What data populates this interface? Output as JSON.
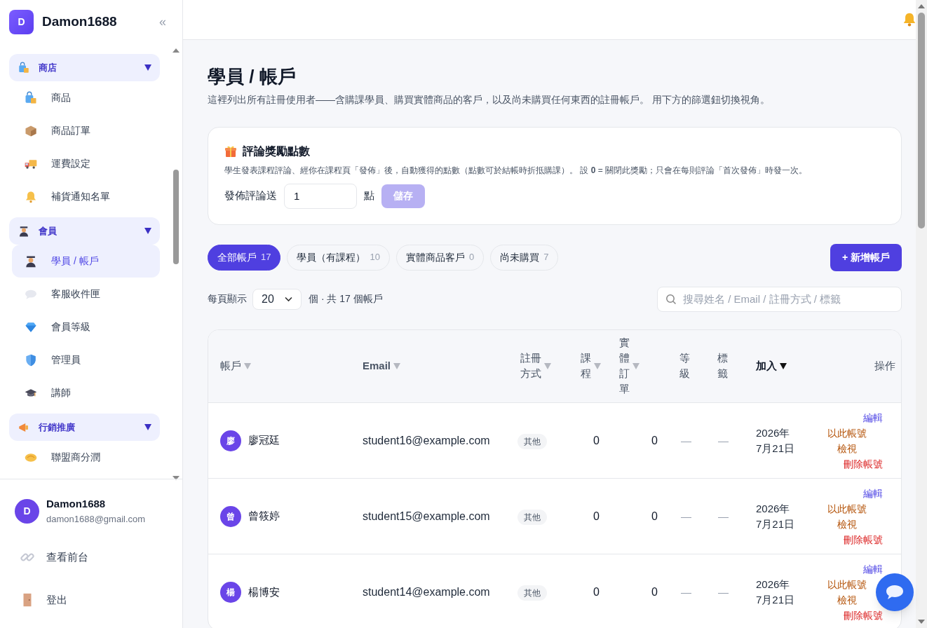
{
  "app": {
    "avatar_letter": "D",
    "name": "Damon1688",
    "collapse": "«"
  },
  "sidebar": {
    "groups": [
      {
        "label": "商店",
        "expanded": true,
        "items": [
          {
            "label": "商品",
            "selected": false
          },
          {
            "label": "商品訂單",
            "selected": false
          },
          {
            "label": "運費設定",
            "selected": false
          },
          {
            "label": "補貨通知名單",
            "selected": false
          }
        ]
      },
      {
        "label": "會員",
        "expanded": true,
        "items": [
          {
            "label": "學員 / 帳戶",
            "selected": true
          },
          {
            "label": "客服收件匣",
            "selected": false
          },
          {
            "label": "會員等級",
            "selected": false
          },
          {
            "label": "管理員",
            "selected": false
          },
          {
            "label": "講師",
            "selected": false
          }
        ]
      },
      {
        "label": "行銷推廣",
        "expanded": true,
        "items": [
          {
            "label": "聯盟商分潤",
            "selected": false
          }
        ]
      }
    ]
  },
  "user": {
    "avatar_letter": "D",
    "name": "Damon1688",
    "email": "damon1688@gmail.com"
  },
  "footer_links": [
    {
      "label": "查看前台"
    },
    {
      "label": "登出"
    }
  ],
  "page": {
    "title": "學員 / 帳戶",
    "description": "這裡列出所有註冊使用者——含購課學員、購買實體商品的客戶，以及尚未購買任何東西的註冊帳戶。 用下方的篩選鈕切換視角。"
  },
  "reward_card": {
    "title": "評論獎勵點數",
    "description": "學生發表課程評論、經你在課程頁「發佈」後，自動獲得的點數（點數可於結帳時折抵購課）。 設 **0** = 關閉此獎勵；只會在每則評論「首次發佈」時發一次。",
    "field_label": "發佈評論送",
    "value": "1",
    "unit": "點",
    "save": {
      "label": "儲存",
      "disabled": true
    }
  },
  "filters": [
    {
      "label": "全部帳戶",
      "count": "17",
      "selected": true
    },
    {
      "label": "學員（有課程）",
      "count": "10",
      "selected": false
    },
    {
      "label": "實體商品客戶",
      "count": "0",
      "selected": false
    },
    {
      "label": "尚未購買",
      "count": "7",
      "selected": false
    }
  ],
  "add_button": "+ 新增帳戶",
  "per_page": {
    "label": "每頁顯示",
    "value": "20",
    "summary": "個 · 共 17 個帳戶"
  },
  "search": {
    "placeholder": "搜尋姓名 / Email / 註冊方式 / 標籤"
  },
  "table": {
    "columns": [
      {
        "label": "帳戶",
        "sortable": true,
        "sorted": false
      },
      {
        "label": "Email",
        "sortable": true,
        "sorted": false
      },
      {
        "label": "註冊方式",
        "sortable": true,
        "sorted": false
      },
      {
        "label": "課程",
        "sortable": true,
        "sorted": false
      },
      {
        "label": "實體訂單",
        "sortable": true,
        "sorted": false
      },
      {
        "label": "等級",
        "sortable": false,
        "sorted": false
      },
      {
        "label": "標籤",
        "sortable": false,
        "sorted": false
      },
      {
        "label": "加入",
        "sortable": true,
        "sorted": true
      },
      {
        "label": "操作",
        "sortable": false,
        "sorted": false
      }
    ],
    "rows": [
      {
        "avatar": "廖",
        "name": "廖冠廷",
        "email": "student16@example.com",
        "method": "其他",
        "courses": "0",
        "orders": "0",
        "level": "—",
        "tags": "—",
        "joined": "2026年7月21日",
        "actions": [
          {
            "kind": "edit",
            "label": "編輯"
          },
          {
            "kind": "impersonate",
            "label": "以此帳號檢視"
          },
          {
            "kind": "delete",
            "label": "刪除帳號"
          }
        ]
      },
      {
        "avatar": "曾",
        "name": "曾筱婷",
        "email": "student15@example.com",
        "method": "其他",
        "courses": "0",
        "orders": "0",
        "level": "—",
        "tags": "—",
        "joined": "2026年7月21日",
        "actions": [
          {
            "kind": "edit",
            "label": "編輯"
          },
          {
            "kind": "impersonate",
            "label": "以此帳號檢視"
          },
          {
            "kind": "delete",
            "label": "刪除帳號"
          }
        ]
      },
      {
        "avatar": "楊",
        "name": "楊博安",
        "email": "student14@example.com",
        "method": "其他",
        "courses": "0",
        "orders": "0",
        "level": "—",
        "tags": "—",
        "joined": "2026年7月21日",
        "actions": [
          {
            "kind": "edit",
            "label": "編輯"
          },
          {
            "kind": "impersonate",
            "label": "以此帳號檢視"
          },
          {
            "kind": "delete",
            "label": "刪除帳號"
          }
        ]
      }
    ]
  }
}
